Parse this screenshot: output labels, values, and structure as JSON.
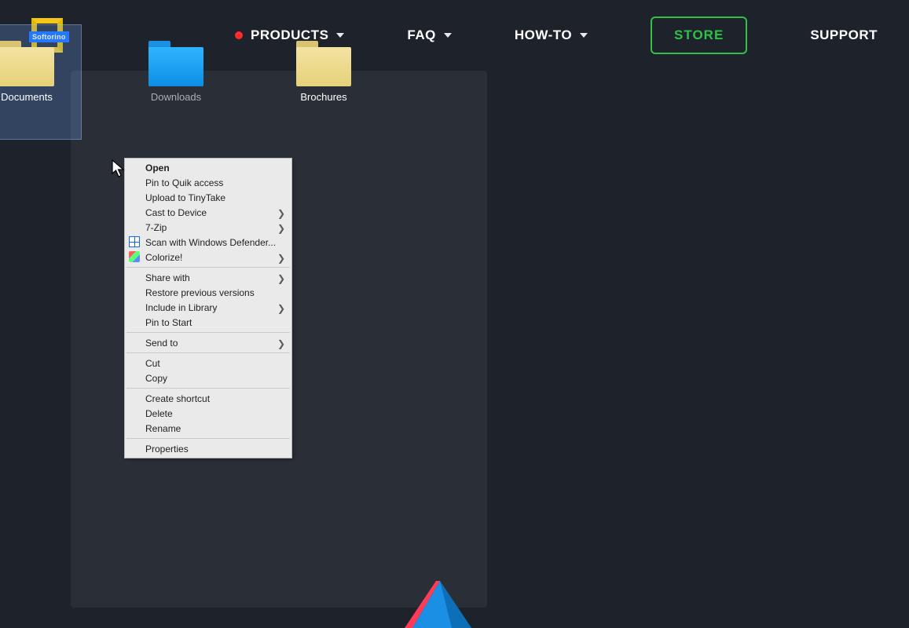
{
  "logo": {
    "badge": "Softorino"
  },
  "nav": {
    "products": "PRODUCTS",
    "faq": "FAQ",
    "howto": "HOW-TO",
    "store": "STORE",
    "support": "SUPPORT"
  },
  "folders": {
    "f1": "Documents",
    "f2": "Downloads",
    "f3": "Brochures"
  },
  "menu": {
    "open": "Open",
    "pin_quick": "Pin to Quik access",
    "upload_tinytake": "Upload to TinyTake",
    "cast": "Cast to Device",
    "sevenzip": "7-Zip",
    "defender": "Scan with Windows Defender...",
    "colorize": "Colorize!",
    "share": "Share with",
    "restore": "Restore previous versions",
    "include_lib": "Include in Library",
    "pin_start": "Pin to Start",
    "send_to": "Send to",
    "cut": "Cut",
    "copy": "Copy",
    "shortcut": "Create shortcut",
    "delete": "Delete",
    "rename": "Rename",
    "properties": "Properties"
  }
}
